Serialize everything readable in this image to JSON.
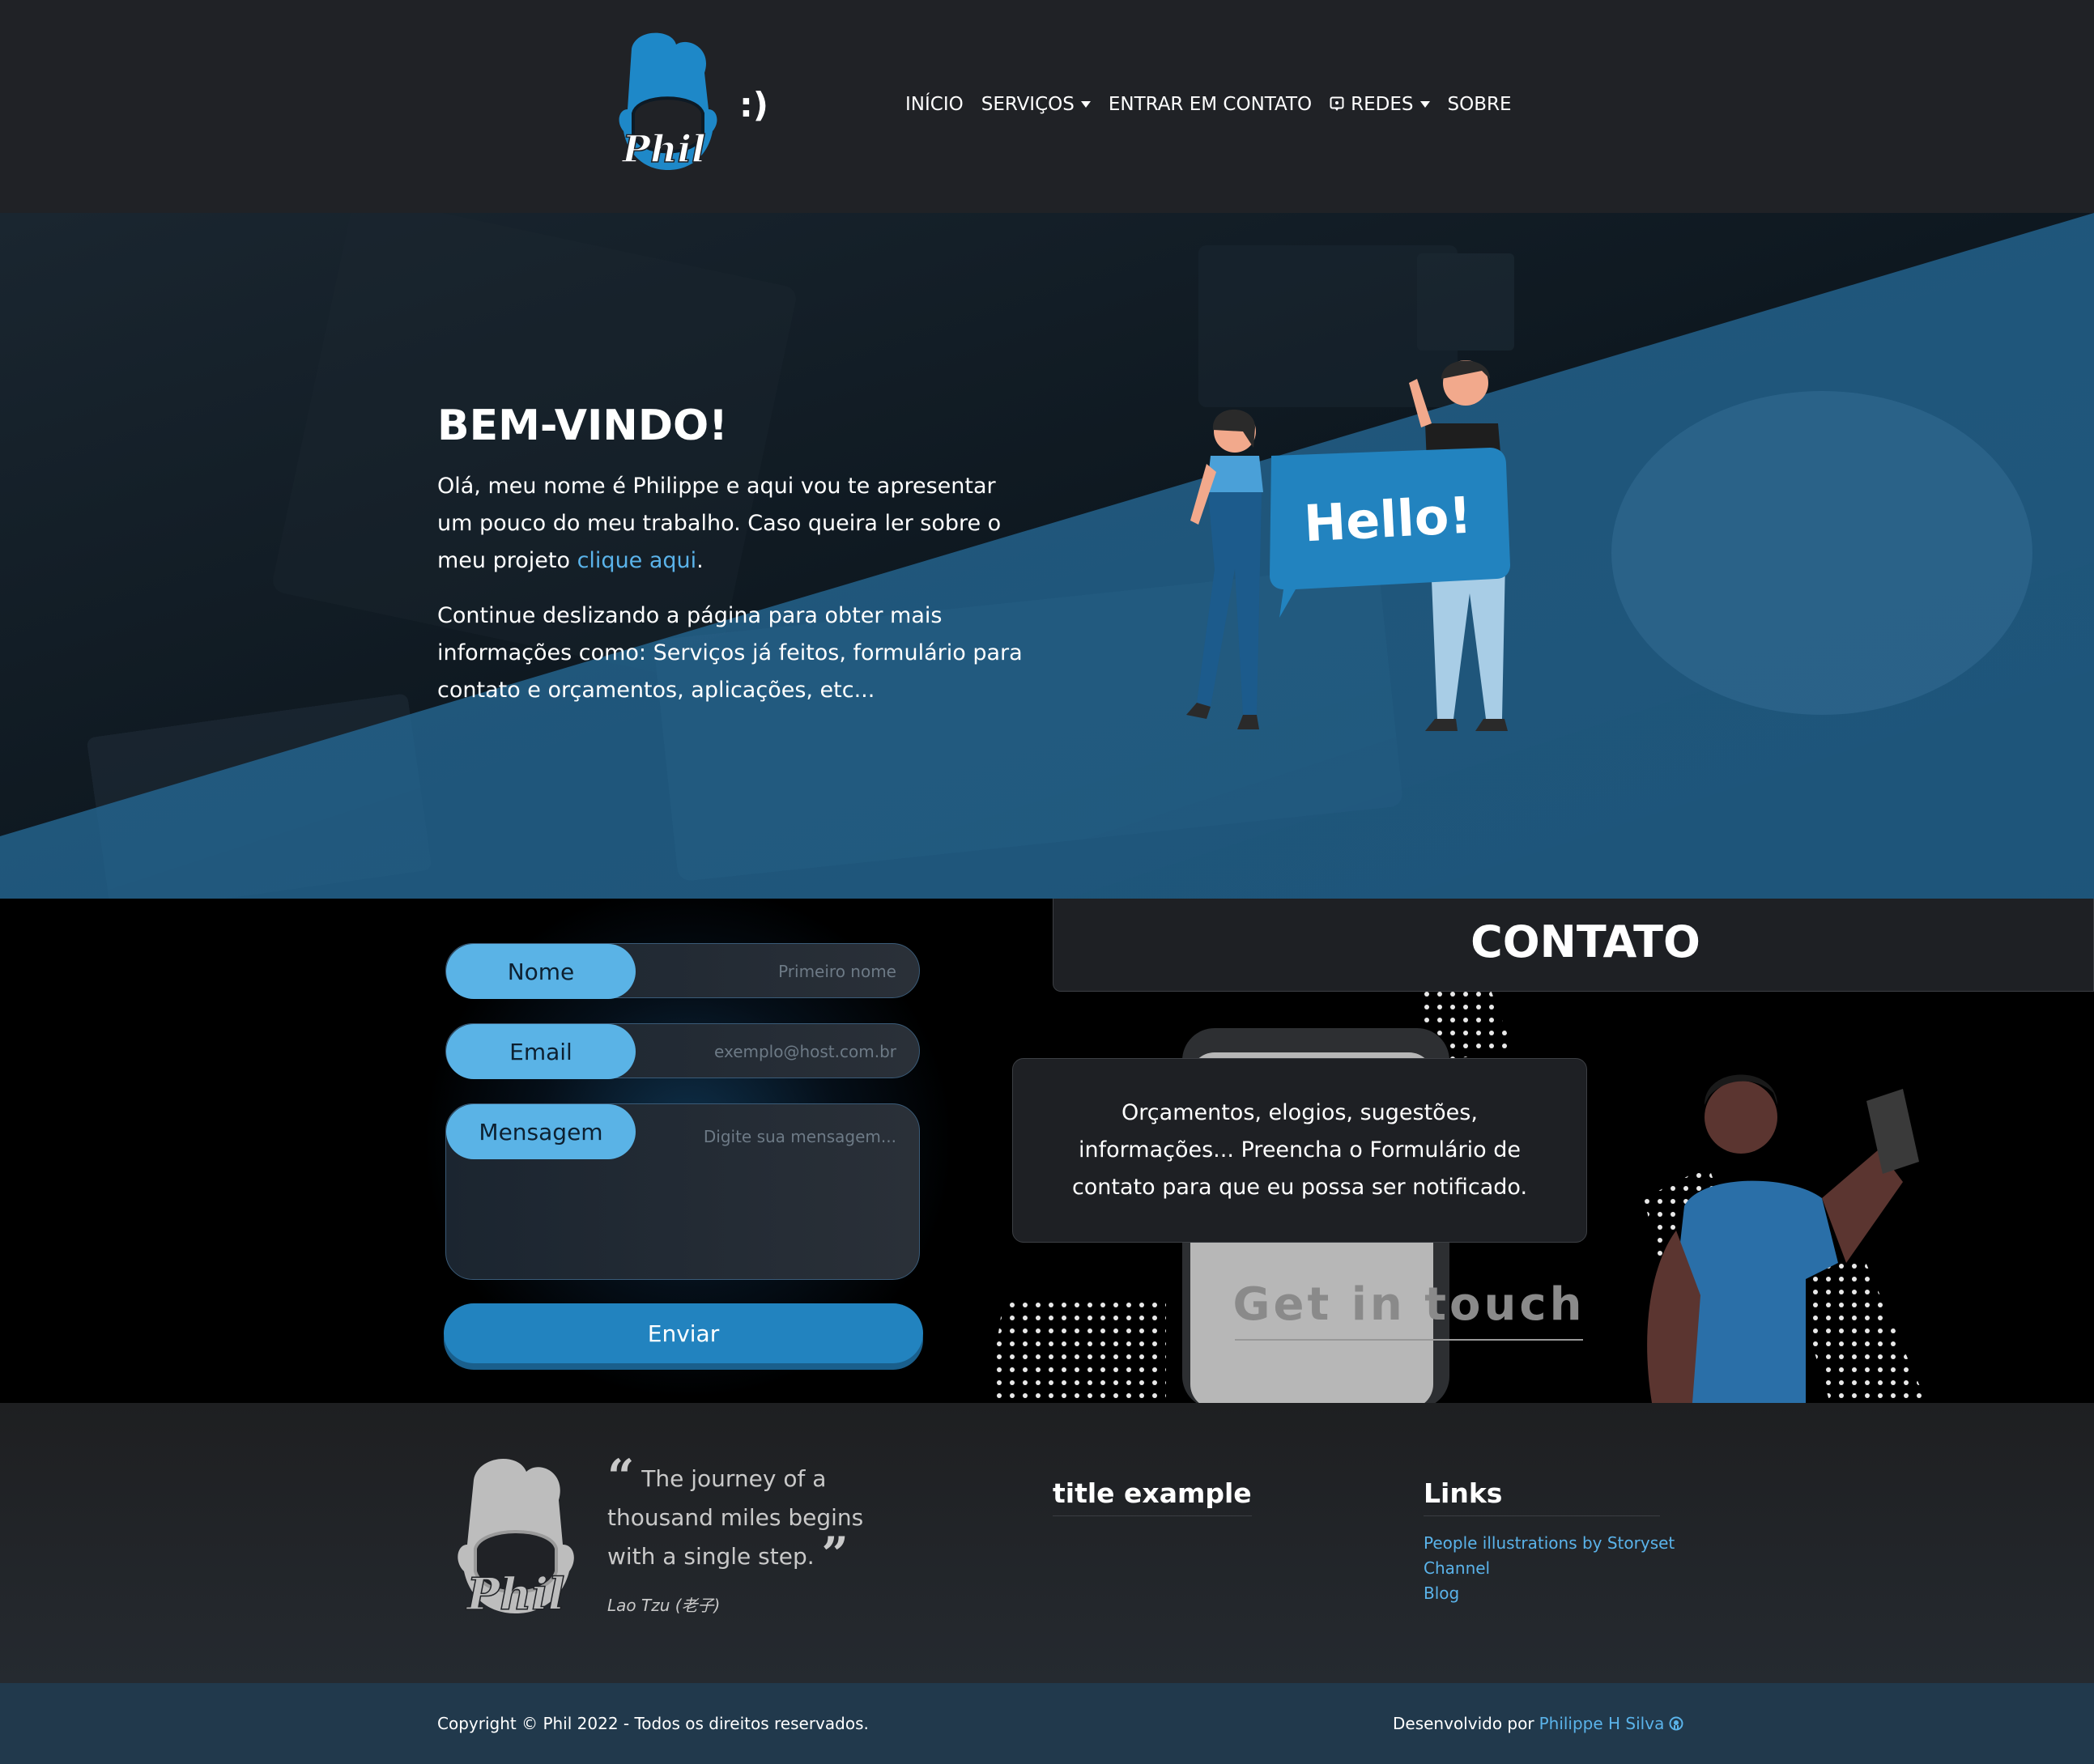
{
  "navbar": {
    "logo_text": "Phil",
    "smile": ":)",
    "items": [
      {
        "label": "INÍCIO"
      },
      {
        "label": "SERVIÇOS"
      },
      {
        "label": "ENTRAR EM CONTATO"
      },
      {
        "label": "REDES"
      },
      {
        "label": "SOBRE"
      }
    ]
  },
  "hero": {
    "title": "BEM-VINDO!",
    "p1_before": "Olá, meu nome é Philippe e aqui vou te apresentar um pouco do meu trabalho. Caso queira ler sobre o meu projeto ",
    "p1_link": "clique aqui",
    "p1_after": ".",
    "p2": "Continue deslizando a página para obter mais informações como: Serviços já feitos, formulário para contato e orçamentos, aplicações, etc...",
    "illustration_text": "Hello!"
  },
  "contact": {
    "header": "CONTATO",
    "form": {
      "name_label": "Nome",
      "name_placeholder": "Primeiro nome",
      "email_label": "Email",
      "email_placeholder": "exemplo@host.com.br",
      "message_label": "Mensagem",
      "message_placeholder": "Digite sua mensagem...",
      "submit": "Enviar"
    },
    "box_text": "Orçamentos, elogios, sugestões, informações... Preencha o Formulário de contato para que eu possa ser notificado.",
    "illustration_text": "Get in touch"
  },
  "footer": {
    "logo_text": "Phil",
    "quote": "The journey of a thousand miles begins with a single step.",
    "quote_author": "Lao Tzu (老子)",
    "col2_title": "title example",
    "links_title": "Links",
    "links": [
      {
        "label": "People illustrations by Storyset"
      },
      {
        "label": "Channel"
      },
      {
        "label": "Blog"
      }
    ],
    "copyright": "Copyright © Phil 2022 - Todos os direitos reservados.",
    "dev_prefix": "Desenvolvido por",
    "dev_name": "Philippe H Silva"
  },
  "colors": {
    "accent": "#5ab3e6",
    "button": "#2283bf",
    "link": "#5ab3ea",
    "bg_dark": "#202226"
  },
  "icons": {
    "redes": "chat-icon",
    "dev": "github-icon"
  }
}
